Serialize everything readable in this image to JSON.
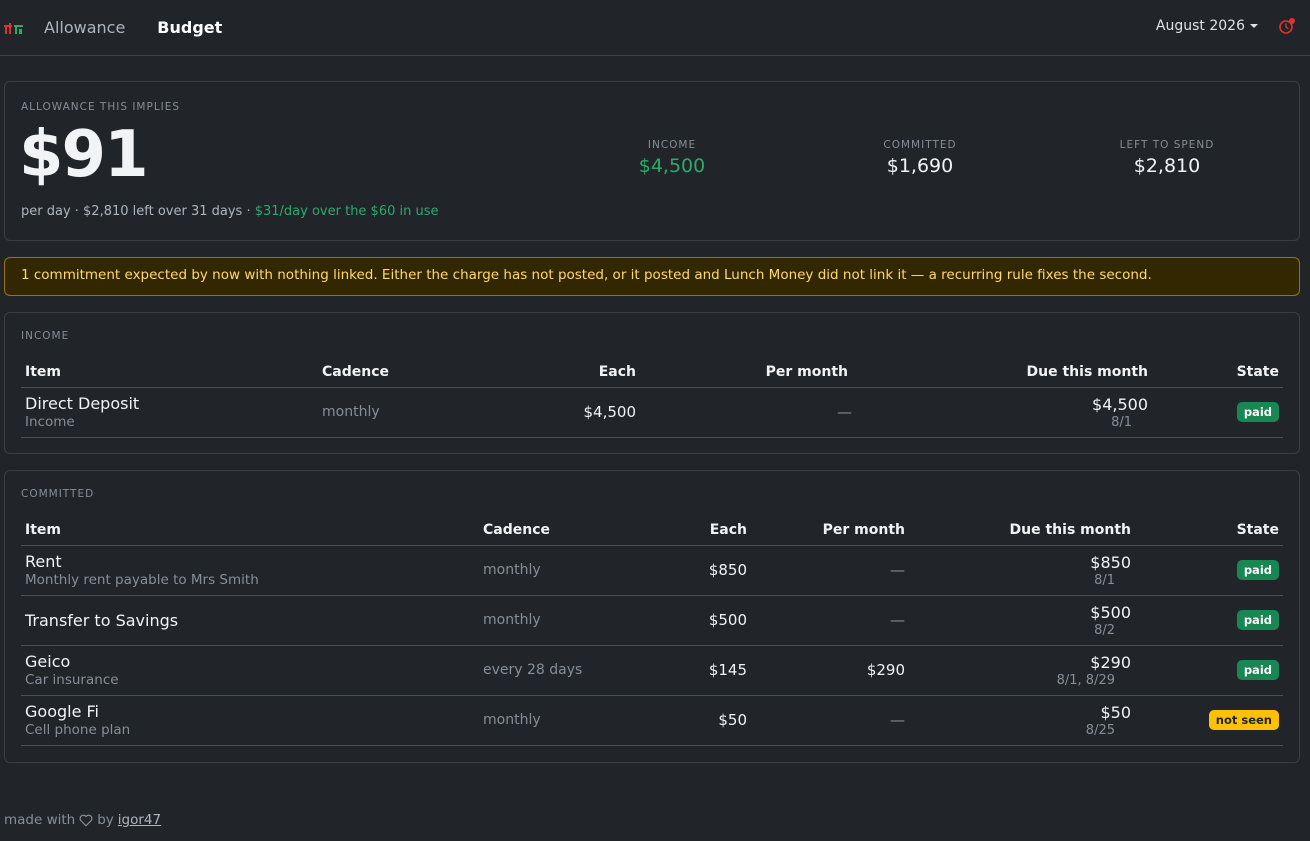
{
  "nav": {
    "links": [
      "Allowance",
      "Budget"
    ],
    "month": "August 2026"
  },
  "summary": {
    "label": "ALLOWANCE THIS IMPLIES",
    "amount": "$91",
    "per_day_text": "per day · $2,810 left over 31 days · ",
    "per_day_delta": "$31/day over the $60 in use",
    "stats": [
      {
        "label": "INCOME",
        "value": "$4,500"
      },
      {
        "label": "COMMITTED",
        "value": "$1,690"
      },
      {
        "label": "LEFT TO SPEND",
        "value": "$2,810"
      }
    ]
  },
  "alert": "1 commitment expected by now with nothing linked. Either the charge has not posted, or it posted and Lunch Money did not link it — a recurring rule fixes the second.",
  "income": {
    "label": "INCOME",
    "columns": [
      "Item",
      "Cadence",
      "Each",
      "Per month",
      "Due this month",
      "State"
    ],
    "rows": [
      {
        "name": "Direct Deposit",
        "sub": "Income",
        "cadence": "monthly",
        "each": "$4,500",
        "per_month": "—",
        "due": "$4,500",
        "due_date": "8/1",
        "state": "paid"
      }
    ]
  },
  "committed": {
    "label": "COMMITTED",
    "columns": [
      "Item",
      "Cadence",
      "Each",
      "Per month",
      "Due this month",
      "State"
    ],
    "rows": [
      {
        "name": "Rent",
        "sub": "Monthly rent payable to Mrs Smith",
        "cadence": "monthly",
        "each": "$850",
        "per_month": "—",
        "due": "$850",
        "due_date": "8/1",
        "state": "paid"
      },
      {
        "name": "Transfer to Savings",
        "sub": "",
        "cadence": "monthly",
        "each": "$500",
        "per_month": "—",
        "due": "$500",
        "due_date": "8/2",
        "state": "paid"
      },
      {
        "name": "Geico",
        "sub": "Car insurance",
        "cadence": "every 28 days",
        "each": "$145",
        "per_month": "$290",
        "due": "$290",
        "due_date": "8/1, 8/29",
        "state": "paid"
      },
      {
        "name": "Google Fi",
        "sub": "Cell phone plan",
        "cadence": "monthly",
        "each": "$50",
        "per_month": "—",
        "due": "$50",
        "due_date": "8/25",
        "state": "not seen"
      }
    ]
  },
  "footer": {
    "prefix": "made with",
    "by": "by",
    "author": "igor47"
  },
  "colors": {
    "background": "#212529",
    "green": "#2ea86b",
    "paid_badge": "#198754",
    "not_seen_badge": "#ffc107",
    "alert_bg": "#332701",
    "alert_text": "#ffda6a",
    "clock_icon": "#e03131"
  }
}
